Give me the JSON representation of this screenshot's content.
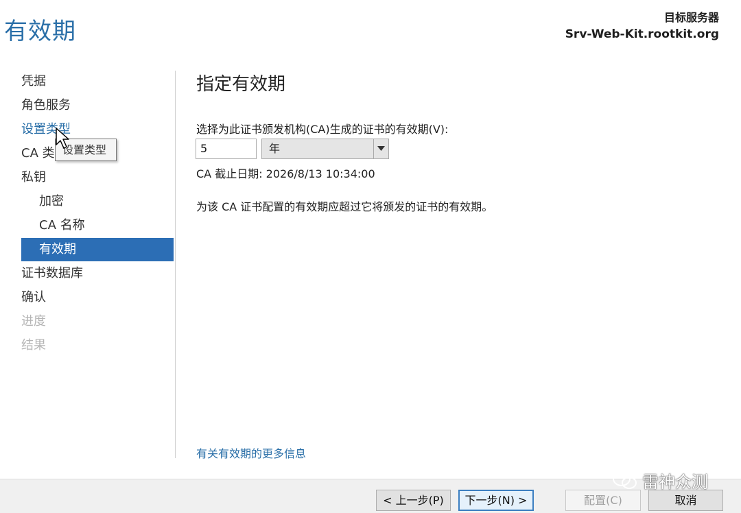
{
  "header": {
    "title": "有效期",
    "target_label": "目标服务器",
    "target_server": "Srv-Web-Kit.rootkit.org"
  },
  "nav": {
    "items": [
      {
        "label": "凭据",
        "state": "normal"
      },
      {
        "label": "角色服务",
        "state": "normal"
      },
      {
        "label": "设置类型",
        "state": "link"
      },
      {
        "label": "CA 类",
        "state": "normal"
      },
      {
        "label": "私钥",
        "state": "normal"
      },
      {
        "label": "加密",
        "state": "sub"
      },
      {
        "label": "CA 名称",
        "state": "sub"
      },
      {
        "label": "有效期",
        "state": "active"
      },
      {
        "label": "证书数据库",
        "state": "normal"
      },
      {
        "label": "确认",
        "state": "normal"
      },
      {
        "label": "进度",
        "state": "disabled"
      },
      {
        "label": "结果",
        "state": "disabled"
      }
    ],
    "tooltip": "设置类型"
  },
  "main": {
    "section_title": "指定有效期",
    "prompt": "选择为此证书颁发机构(CA)生成的证书的有效期(V):",
    "period_value": "5",
    "period_unit": "年",
    "expiry": "CA 截止日期: 2026/8/13 10:34:00",
    "note": "为该 CA 证书配置的有效期应超过它将颁发的证书的有效期。",
    "more_info": "有关有效期的更多信息"
  },
  "buttons": {
    "back": "< 上一步(P)",
    "next": "下一步(N) >",
    "configure": "配置(C)",
    "cancel": "取消"
  },
  "watermark": "雷神众测",
  "colors": {
    "accent": "#2a6fa8",
    "active_nav": "#2c6eb5",
    "disabled": "#b5b5b5"
  }
}
